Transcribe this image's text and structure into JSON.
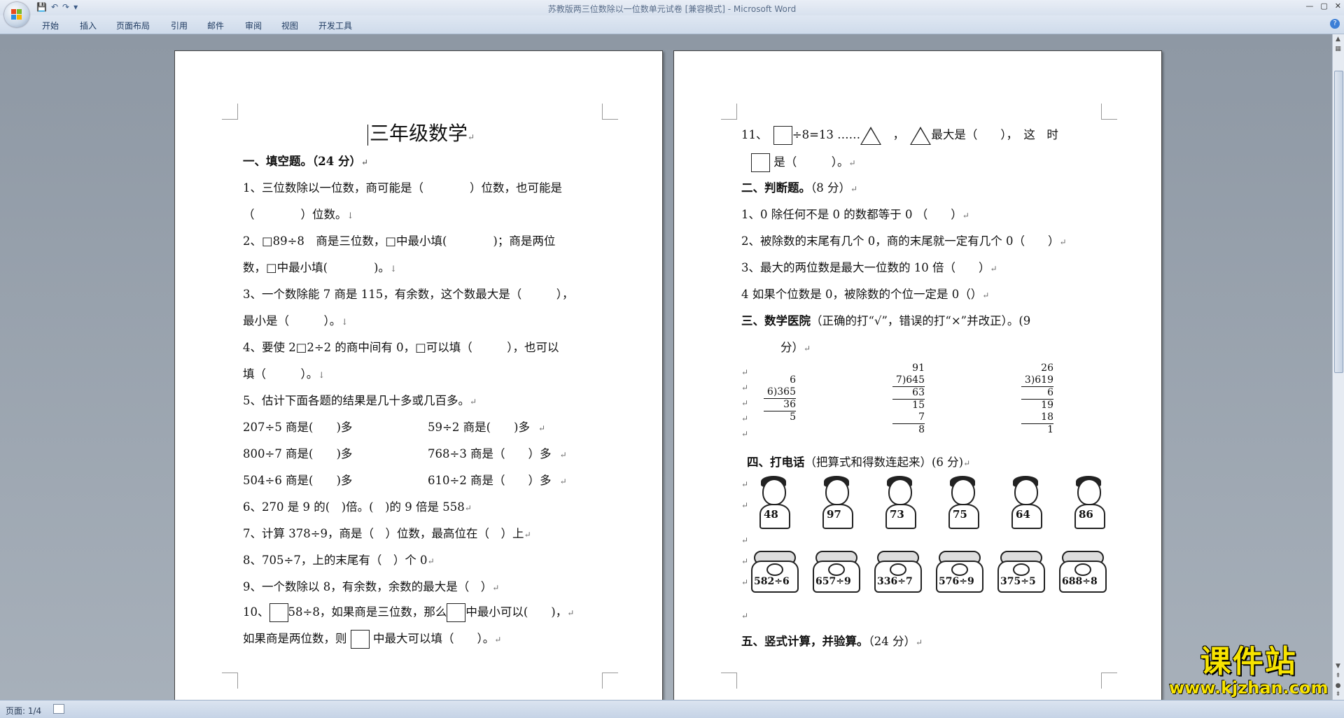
{
  "window": {
    "title": "苏教版两三位数除以一位数单元试卷 [兼容模式] - Microsoft Word",
    "controls": [
      "—",
      "▢",
      "✕"
    ],
    "help": "?"
  },
  "quick_access": {
    "save": "💾",
    "undo": "↶",
    "redo": "↷",
    "more": "▾"
  },
  "ribbon_tabs": [
    "开始",
    "插入",
    "页面布局",
    "引用",
    "邮件",
    "审阅",
    "视图",
    "开发工具"
  ],
  "status": {
    "page": "页面: 1/4"
  },
  "page1": {
    "title": "三年级数学",
    "sec1": "一、填空题。（24 分）",
    "lines": [
      "1、三位数除以一位数，商可能是（　　　　）位数，也可能是",
      "（　　　　）位数。",
      "2、□89÷8　商是三位数，□中最小填(　　　　)；商是两位",
      "数，□中最小填(　　　　)。",
      "3、一个数除能 7 商是 115，有余数，这个数最大是（　　　），",
      "最小是（　　　）。",
      "4、要使 2□2÷2 的商中间有 0，□可以填（　　　），也可以",
      "填（　　　）。",
      "5、估计下面各题的结果是几十多或几百多。"
    ],
    "estimate": [
      {
        "a": "207÷5 商是(　　)多",
        "b": "59÷2 商是(　　)多"
      },
      {
        "a": "800÷7 商是(　　)多",
        "b": "768÷3 商是（　　）多"
      },
      {
        "a": "504÷6 商是(　　)多",
        "b": "610÷2 商是（　　）多"
      }
    ],
    "lines2": [
      "6、270 是 9 的(　)倍。(　)的 9 倍是 558",
      "7、计算 378÷9，商是（　）位数，最高位在（　）上",
      "8、705÷7，上的末尾有（　）个 0",
      "9、一个数除以 8，有余数，余数的最大是（　）"
    ],
    "q10a": "10、",
    "q10b": "58÷8，如果商是三位数，那么",
    "q10c": "中最小可以(　　)，",
    "q10d": "如果商是两位数，则",
    "q10e": "中最大可以填（　　）。"
  },
  "page2": {
    "q11a": "11、",
    "q11b": "÷8=13 ……",
    "q11c": "，",
    "q11d": "最大是（　　），　这　时",
    "q11e": "是（　　　）。",
    "sec2": "二、判断题。",
    "sec2score": "（8 分）",
    "judge": [
      "1、0 除任何不是 0 的数都等于 0 （　　）",
      "2、被除数的末尾有几个 0，商的末尾就一定有几个 0（　　）",
      "3、最大的两位数是最大一位数的 10 倍（　　）",
      "4 如果个位数是 0，被除数的个位一定是 0（）"
    ],
    "sec3": "三、数学医院",
    "sec3note": "（正确的打“√”，错误的打“×”并改正）。(9",
    "sec3tail": "分）",
    "div1": {
      "q": "6",
      "expr": "6)365",
      "s1": "36",
      "r": "5"
    },
    "div2": {
      "q": "91",
      "expr": "7)645",
      "s1": "63",
      "r1": "15",
      "s2": "7",
      "r": "8"
    },
    "div3": {
      "q": "26",
      "expr": "3)619",
      "s1": "6",
      "r1": "19",
      "s2": "18",
      "r": "1"
    },
    "sec4": "四、打电话",
    "sec4note": "（把算式和得数连起来）(6 分)",
    "people": [
      "48",
      "97",
      "73",
      "75",
      "64",
      "86"
    ],
    "phones": [
      "582÷6",
      "657÷9",
      "336÷7",
      "576÷9",
      "375÷5",
      "688÷8"
    ],
    "sec5": "五、竖式计算，并验算。",
    "sec5score": "（24 分）"
  },
  "watermark": {
    "big": "课件站",
    "small": "www.kjzhan.com"
  }
}
